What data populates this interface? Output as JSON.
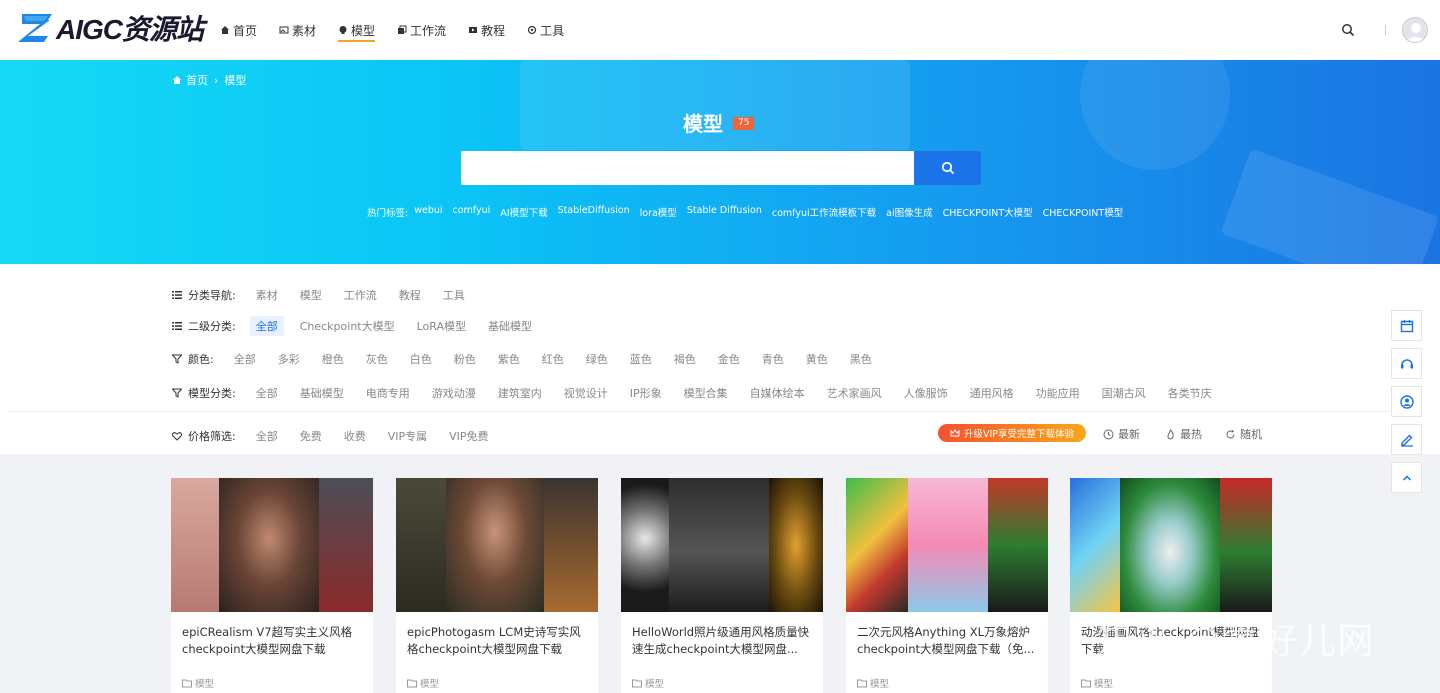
{
  "header": {
    "logo_text": "AIGC资源站",
    "nav": [
      {
        "label": "首页",
        "icon": "home-icon"
      },
      {
        "label": "素材",
        "icon": "image-icon"
      },
      {
        "label": "模型",
        "icon": "skull-icon",
        "active": true
      },
      {
        "label": "工作流",
        "icon": "copy-icon"
      },
      {
        "label": "教程",
        "icon": "video-icon"
      },
      {
        "label": "工具",
        "icon": "gear-icon"
      }
    ]
  },
  "banner": {
    "breadcrumb": {
      "home": "首页",
      "sep": "›",
      "current": "模型"
    },
    "title": "模型",
    "count": "75",
    "search_placeholder": "",
    "hot_label": "热门标签:",
    "hot_tags": [
      "webui",
      "comfyui",
      "AI模型下载",
      "StableDiffusion",
      "lora模型",
      "Stable Diffusion",
      "comfyui工作流模板下载",
      "ai图像生成",
      "CHECKPOINT大模型",
      "CHECKPOINT模型"
    ]
  },
  "filters": {
    "category": {
      "label": "分类导航:",
      "options": [
        "素材",
        "模型",
        "工作流",
        "教程",
        "工具"
      ]
    },
    "subcategory": {
      "label": "二级分类:",
      "options": [
        "全部",
        "Checkpoint大模型",
        "LoRA模型",
        "基础模型"
      ]
    },
    "color": {
      "label": "颜色:",
      "options": [
        "全部",
        "多彩",
        "橙色",
        "灰色",
        "白色",
        "粉色",
        "紫色",
        "红色",
        "绿色",
        "蓝色",
        "褐色",
        "金色",
        "青色",
        "黄色",
        "黑色"
      ]
    },
    "model_type": {
      "label": "模型分类:",
      "options": [
        "全部",
        "基础模型",
        "电商专用",
        "游戏动漫",
        "建筑室内",
        "视觉设计",
        "IP形象",
        "模型合集",
        "自媒体绘本",
        "艺术家画风",
        "人像服饰",
        "通用风格",
        "功能应用",
        "国潮古风",
        "各类节庆"
      ]
    },
    "price": {
      "label": "价格筛选:",
      "options": [
        "全部",
        "免费",
        "收费",
        "VIP专属",
        "VIP免费"
      ]
    },
    "vip_promo": "升级VIP享受完整下载体验",
    "sort": {
      "latest": "最新",
      "hottest": "最热",
      "random": "随机"
    }
  },
  "cards": [
    {
      "title": "epiCRealism V7超写实主义风格checkpoint大模型网盘下载",
      "category": "模型"
    },
    {
      "title": "epicPhotogasm LCM史诗写实风格checkpoint大模型网盘下载",
      "category": "模型"
    },
    {
      "title": "HelloWorld照片级通用风格质量快速生成checkpoint大模型网盘...",
      "category": "模型"
    },
    {
      "title": "二次元风格Anything XL万象熔炉checkpoint大模型网盘下载（免...",
      "category": "模型"
    },
    {
      "title": "动漫插画风格checkpoint模型网盘下载",
      "category": "模型"
    }
  ],
  "watermark": "知乎 @喜好儿网",
  "colors": {
    "accent": "#1a73e8",
    "nav_underline": "#f5a623",
    "badge": "#f0643c"
  }
}
